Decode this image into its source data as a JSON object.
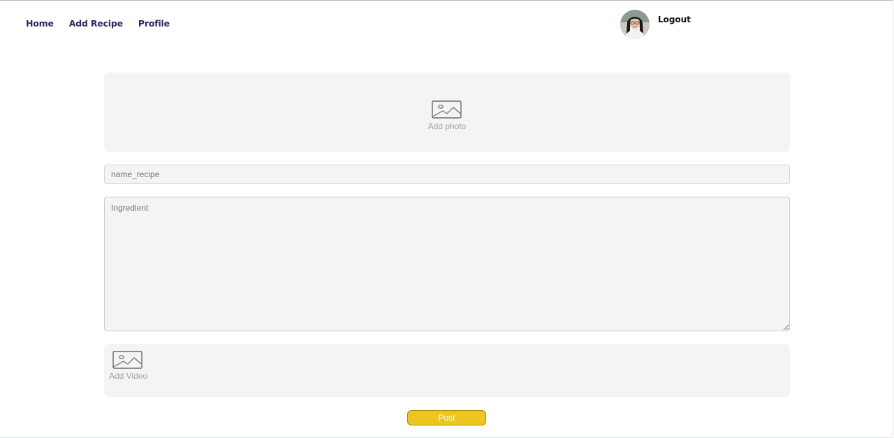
{
  "nav": {
    "home": "Home",
    "add_recipe": "Add Recipe",
    "profile": "Profile"
  },
  "user": {
    "logout": "Logout"
  },
  "form": {
    "photo_label": "Add photo",
    "name_placeholder": "name_recipe",
    "ingredient_placeholder": "Ingredient",
    "video_label": "Add Video",
    "post_label": "Post"
  },
  "icons": {
    "photo": "image-icon",
    "video": "image-icon",
    "avatar": "avatar"
  },
  "colors": {
    "nav_text": "#2b2962",
    "box_background": "#f5f4f2",
    "post_button": "#eec51e",
    "muted_label": "#9aa2a8"
  }
}
